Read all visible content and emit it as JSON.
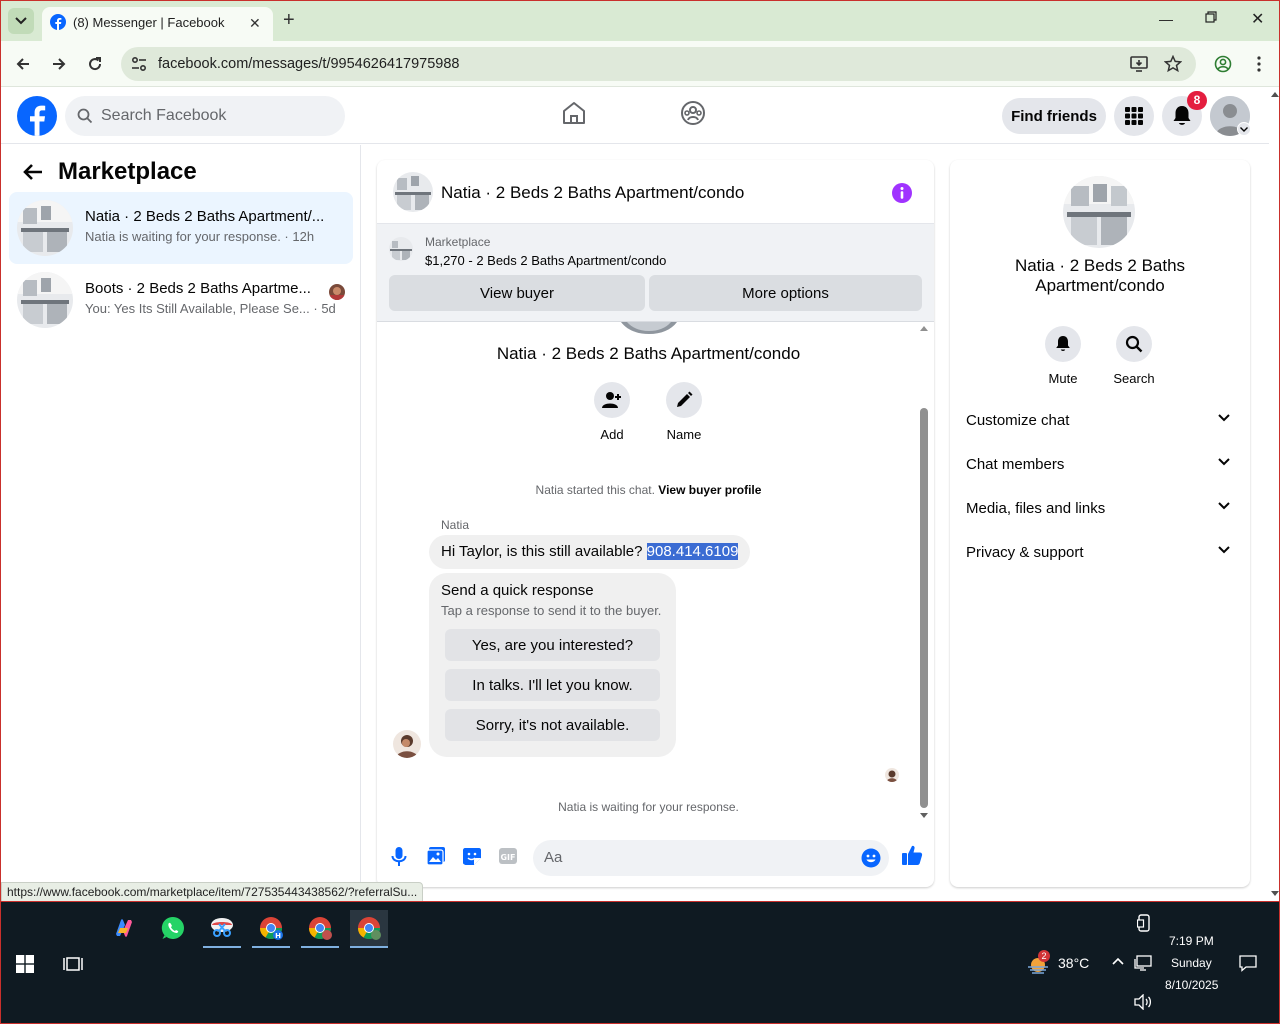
{
  "browser": {
    "tab_title": "(8) Messenger | Facebook",
    "url": "facebook.com/messages/t/9954626417975988",
    "status_url": "https://www.facebook.com/marketplace/item/727535443438562/?referralSu..."
  },
  "fb_header": {
    "search_placeholder": "Search Facebook",
    "find_friends": "Find friends",
    "notification_count": "8"
  },
  "sidebar": {
    "title": "Marketplace",
    "conversations": [
      {
        "name": "Natia · 2 Beds 2 Baths Apartment/...",
        "snippet": "Natia is waiting for your response. · 12h"
      },
      {
        "name": "Boots · 2 Beds 2 Baths Apartme...",
        "snippet": "You: Yes Its Still Available, Please Se... · 5d"
      }
    ]
  },
  "chat": {
    "header_title": "Natia · 2 Beds 2 Baths Apartment/condo",
    "marketplace_label": "Marketplace",
    "listing": "$1,270 - 2 Beds 2 Baths Apartment/condo",
    "view_buyer": "View buyer",
    "more_options": "More options",
    "big_name": "Natia · 2 Beds 2 Baths Apartment/condo",
    "add_label": "Add",
    "name_label": "Name",
    "started_text": "Natia started this chat.",
    "view_buyer_profile": "View buyer profile",
    "sender": "Natia",
    "message_text": "Hi Taylor, is this still available? ",
    "message_phone": "908.414.6109",
    "quick_title": "Send a quick response",
    "quick_sub": "Tap a response to send it to the buyer.",
    "quick_options": [
      "Yes, are you interested?",
      "In talks. I'll let you know.",
      "Sorry, it's not available."
    ],
    "waiting_text": "Natia is waiting for your response.",
    "composer_placeholder": "Aa"
  },
  "right_panel": {
    "name": "Natia · 2 Beds 2 Baths Apartment/condo",
    "mute": "Mute",
    "search": "Search",
    "sections": [
      "Customize chat",
      "Chat members",
      "Media, files and links",
      "Privacy & support"
    ]
  },
  "taskbar": {
    "temperature": "38°C",
    "weather_badge": "2",
    "time": "7:19 PM",
    "day": "Sunday",
    "date": "8/10/2025"
  },
  "colors": {
    "fb_blue": "#0866ff",
    "tab_green": "#d9ead3",
    "notif_red": "#e41e3f",
    "info_purple": "#a033ff",
    "selection": "#3b6cd3"
  }
}
